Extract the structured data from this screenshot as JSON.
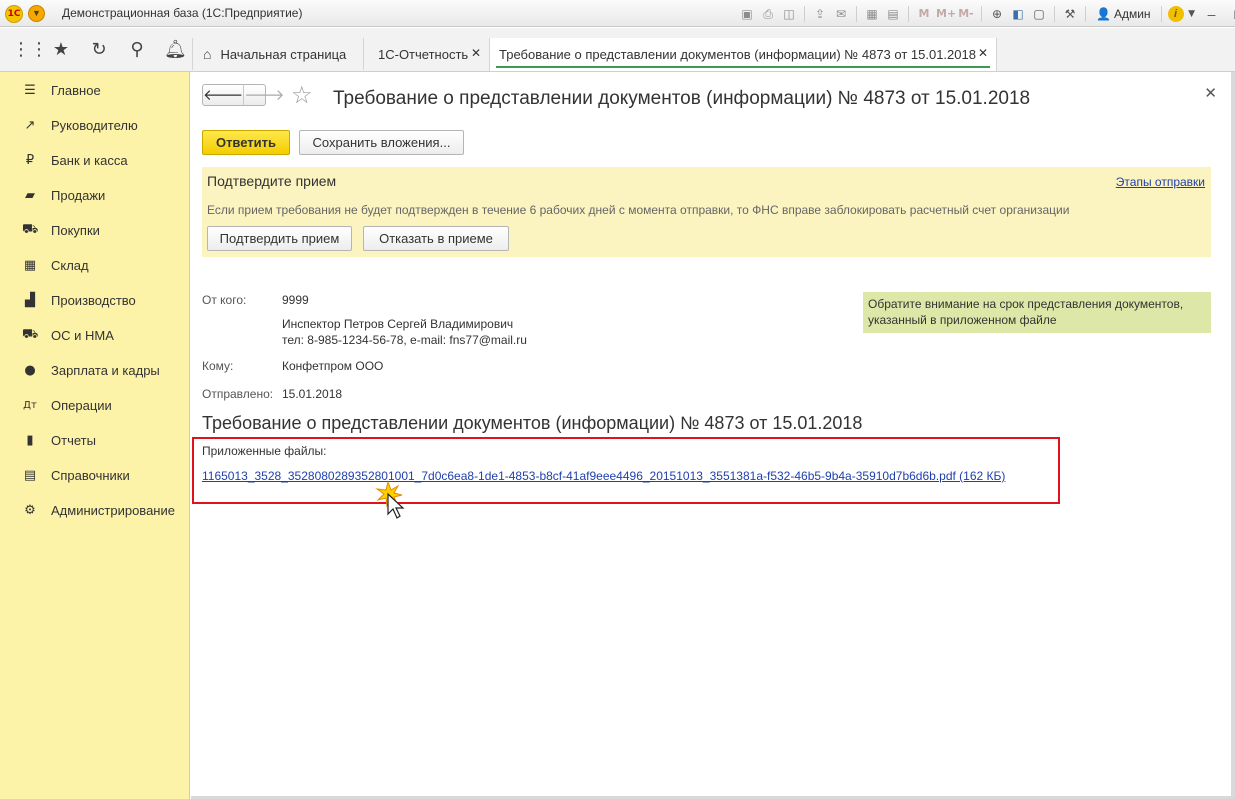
{
  "window": {
    "logo_text": "1С",
    "title": "Демонстрационная база  (1С:Предприятие)",
    "user": "Админ",
    "toolbar_m_labels": [
      "M",
      "M+",
      "M-"
    ]
  },
  "tabs": [
    {
      "label": "Начальная страница"
    },
    {
      "label": "1С-Отчетность"
    },
    {
      "label": "Требование о представлении документов (информации) № 4873 от 15.01.2018"
    }
  ],
  "sidebar": {
    "items": [
      {
        "label": "Главное",
        "icon": "menu-icon"
      },
      {
        "label": "Руководителю",
        "icon": "trend-icon"
      },
      {
        "label": "Банк и касса",
        "icon": "ruble-icon"
      },
      {
        "label": "Продажи",
        "icon": "bag-icon"
      },
      {
        "label": "Покупки",
        "icon": "cart-icon"
      },
      {
        "label": "Склад",
        "icon": "warehouse-icon"
      },
      {
        "label": "Производство",
        "icon": "factory-icon"
      },
      {
        "label": "ОС и НМА",
        "icon": "truck-icon"
      },
      {
        "label": "Зарплата и кадры",
        "icon": "person-icon"
      },
      {
        "label": "Операции",
        "icon": "debit-credit-icon"
      },
      {
        "label": "Отчеты",
        "icon": "bar-chart-icon"
      },
      {
        "label": "Справочники",
        "icon": "book-icon"
      },
      {
        "label": "Администрирование",
        "icon": "gear-icon"
      }
    ]
  },
  "form": {
    "title": "Требование о представлении документов (информации)  № 4873 от 15.01.2018",
    "buttons": {
      "reply": "Ответить",
      "save_attachments": "Сохранить вложения..."
    },
    "notice": {
      "title": "Подтвердите прием",
      "text": "Если прием требования не будет подтвержден в течение 6 рабочих дней с момента отправки, то ФНС вправе заблокировать расчетный счет организации",
      "link": "Этапы отправки",
      "confirm": "Подтвердить прием",
      "reject": "Отказать в приеме"
    },
    "hint": "Обратите внимание на срок представления документов, указанный в приложенном файле",
    "from_label": "От кого:",
    "from_code": "9999",
    "from_name": "Инспектор Петров Сергей Владимирович",
    "from_contacts": "тел: 8-985-1234-56-78, e-mail: fns77@mail.ru",
    "to_label": "Кому:",
    "to_value": "Конфетпром ООО",
    "sent_label": "Отправлено:",
    "sent_value": "15.01.2018",
    "heading": "Требование о представлении документов (информации) № 4873 от 15.01.2018",
    "files_label": "Приложенные файлы:",
    "file_link": "1165013_3528_3528080289352801001_7d0c6ea8-1de1-4853-b8cf-41af9eee4496_20151013_3551381a-f532-46b5-9b4a-35910d7b6d6b.pdf (162 КБ)"
  },
  "colors": {
    "sidebar_bg": "#fdf3a8",
    "primary_button": "#f4cd00",
    "notice_bg": "#fbf3c0",
    "hint_bg": "#dde8a8",
    "link": "#1f3fae",
    "highlight": "#e2121c",
    "active_tab_underline": "#3a9b57"
  }
}
